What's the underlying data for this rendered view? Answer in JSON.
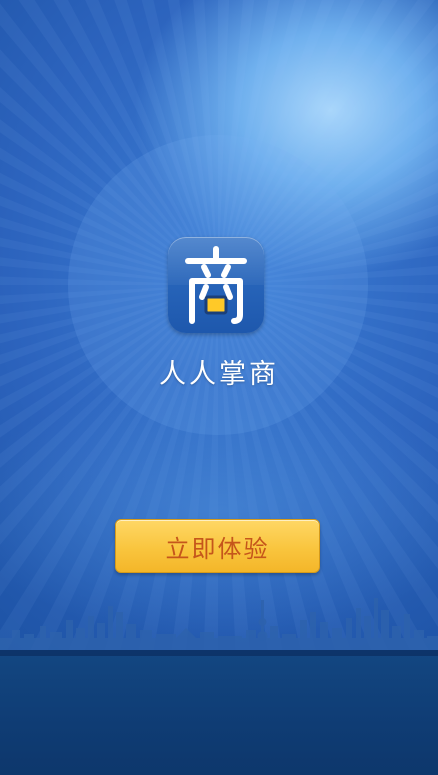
{
  "splash": {
    "app_icon_glyph": "商",
    "app_name": "人人掌商",
    "start_button_label": "立即体验"
  },
  "colors": {
    "background_top": "#3d7fd6",
    "background_bottom": "#1a4e9a",
    "ground": "#0f3c74",
    "icon_blue": "#1e58ad",
    "button_yellow": "#f9c53e",
    "button_text": "#c5561b",
    "app_name_text": "#ffffff"
  },
  "icons": {
    "app_icon": "shang-logo-icon"
  }
}
